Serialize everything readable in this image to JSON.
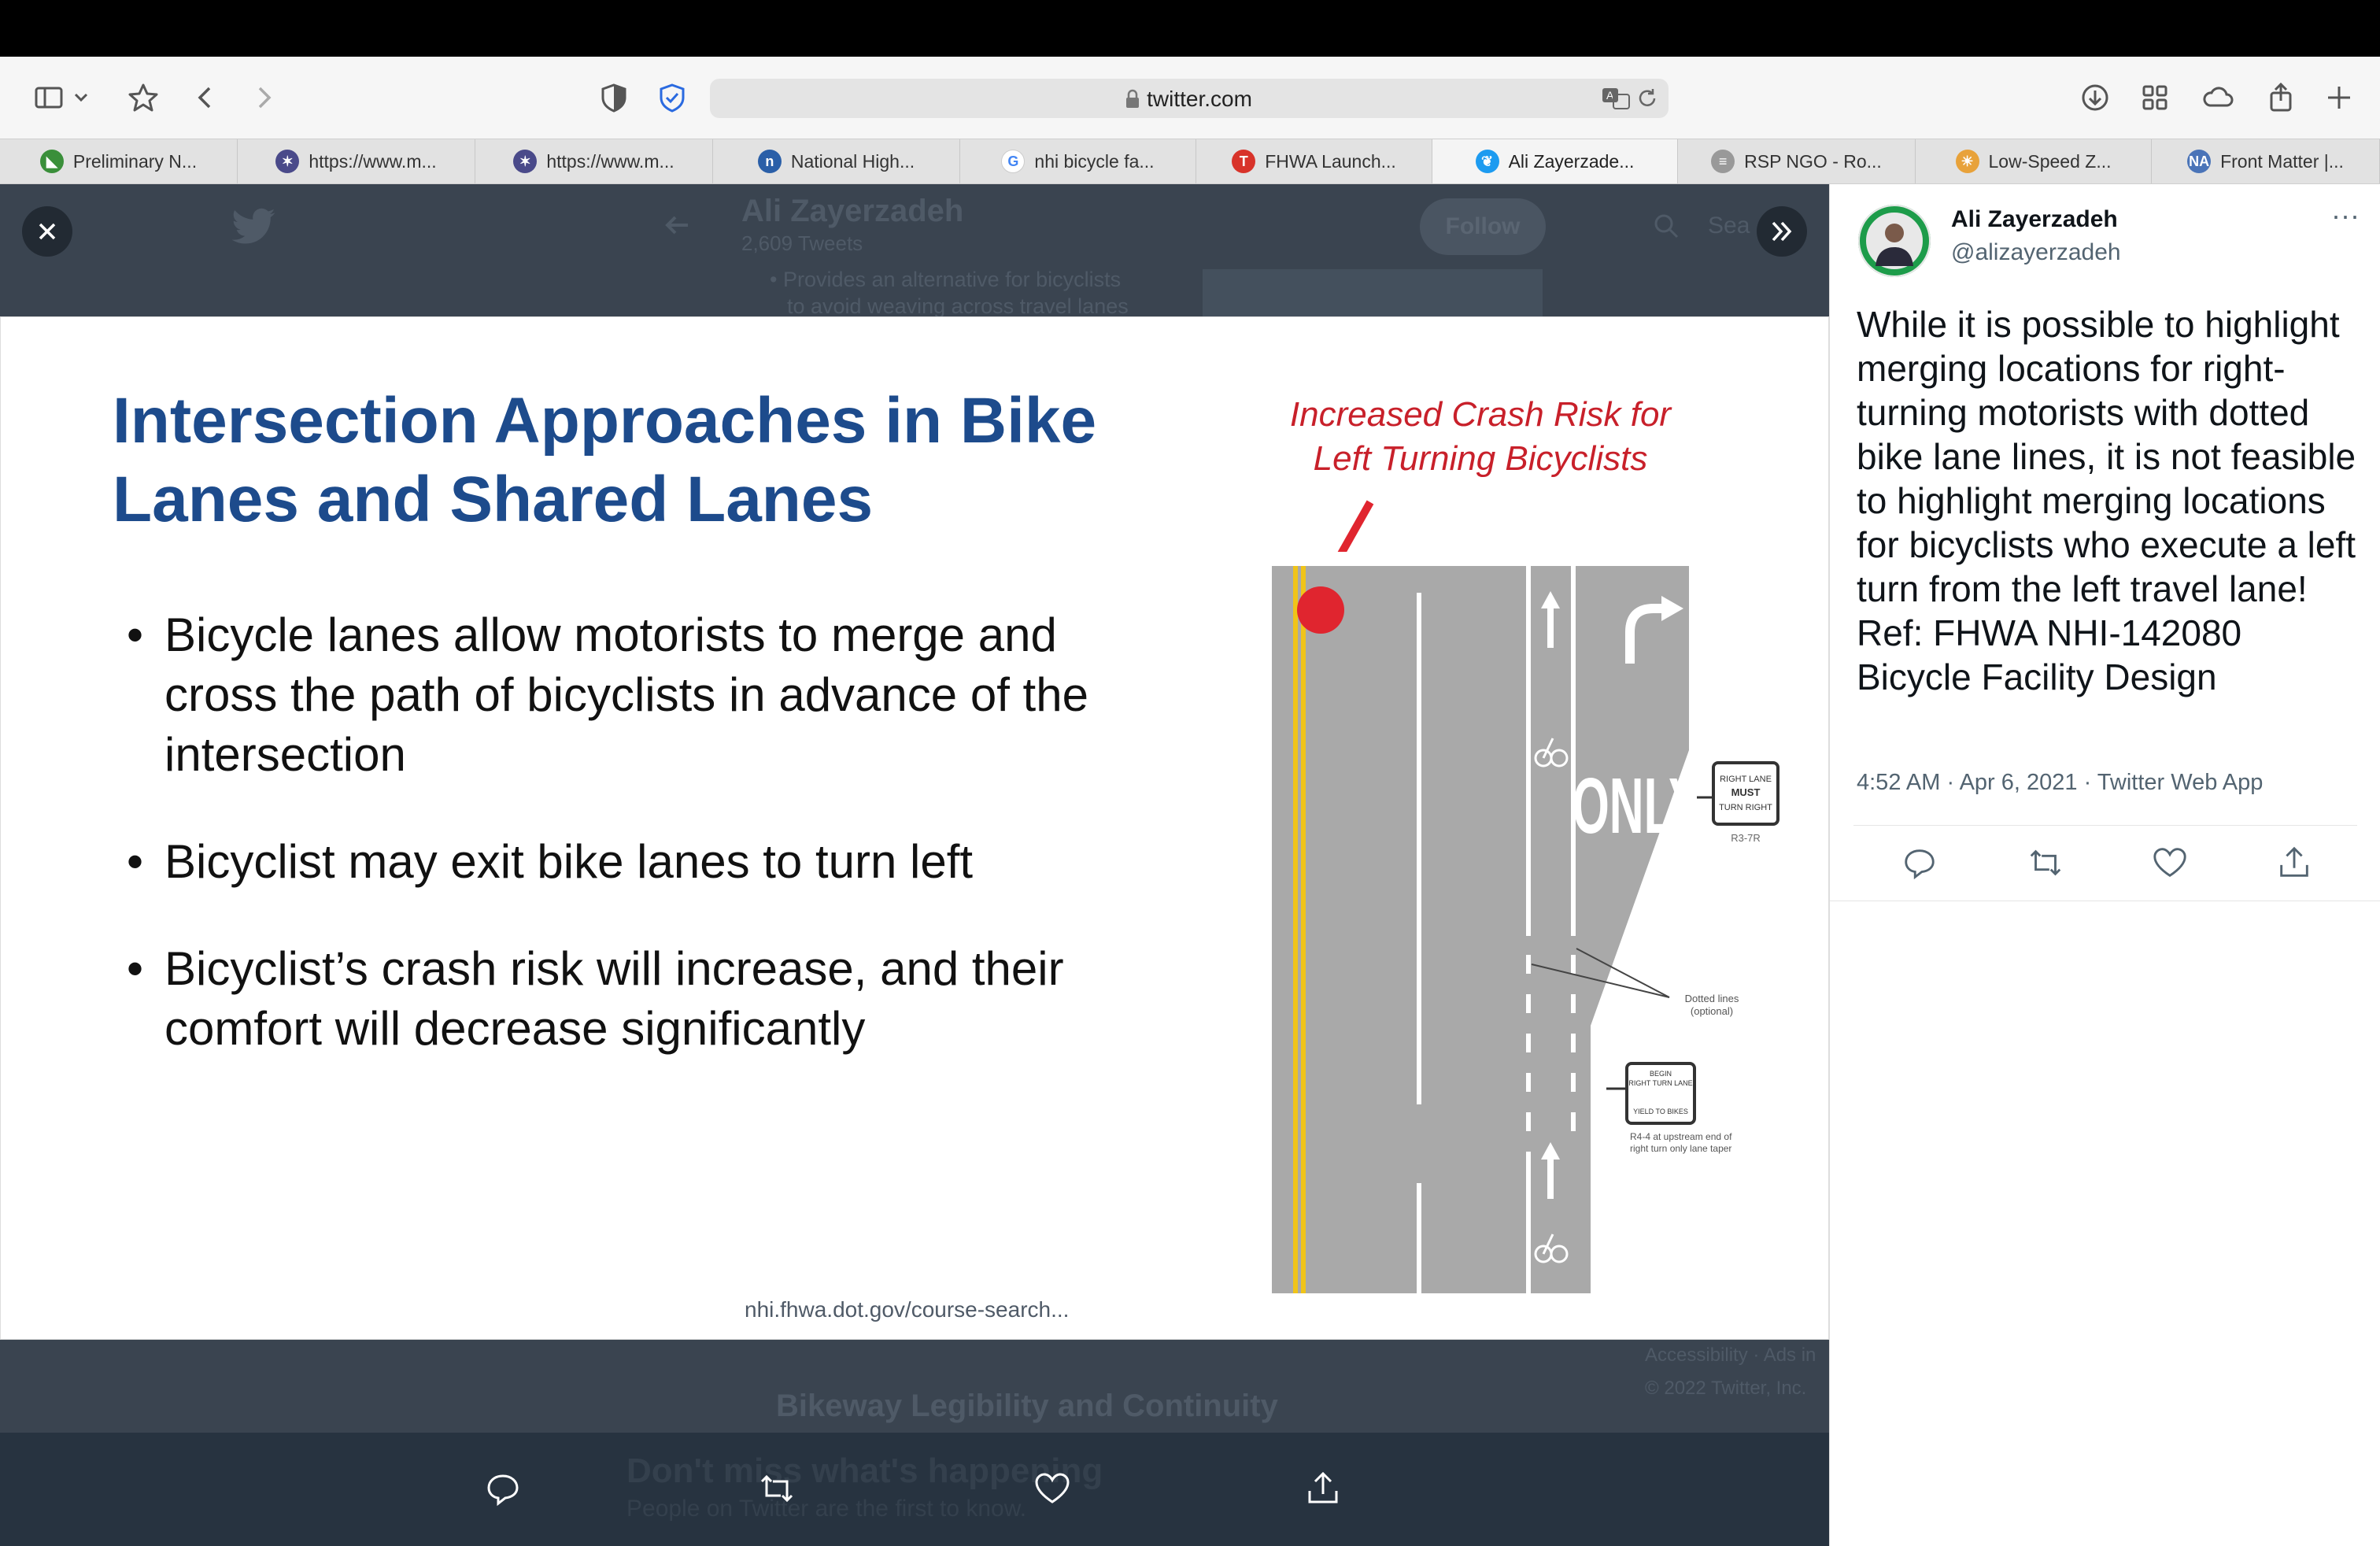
{
  "browser": {
    "url": "twitter.com",
    "icons": [
      "sidebar-icon",
      "chevron-down-icon",
      "bookmark-star-icon",
      "back-icon",
      "forward-icon",
      "privacy-shield-icon",
      "password-shield-icon",
      "lock-icon",
      "translate-icon",
      "reload-icon",
      "downloads-icon",
      "tab-overview-icon",
      "icloud-icon",
      "share-icon",
      "new-tab-icon"
    ],
    "tabs": [
      {
        "label": "Preliminary N...",
        "favicon": "green-chart-favicon",
        "color": "#3a8f3a"
      },
      {
        "label": "https://www.m...",
        "favicon": "star-favicon",
        "color": "#4a4a8a"
      },
      {
        "label": "https://www.m...",
        "favicon": "star-favicon",
        "color": "#4a4a8a"
      },
      {
        "label": "National High...",
        "favicon": "nhi-favicon",
        "color": "#2a5fa8"
      },
      {
        "label": "nhi bicycle fa...",
        "favicon": "google-favicon",
        "color": "#ffffff"
      },
      {
        "label": "FHWA Launch...",
        "favicon": "t-favicon",
        "color": "#d8332a"
      },
      {
        "label": "Ali Zayerzade...",
        "favicon": "twitter-favicon",
        "color": "#1d9bf0",
        "active": true
      },
      {
        "label": "RSP NGO - Ro...",
        "favicon": "document-favicon",
        "color": "#999999"
      },
      {
        "label": "Low-Speed Z...",
        "favicon": "sun-favicon",
        "color": "#e8a23a"
      },
      {
        "label": "Front Matter |...",
        "favicon": "na-favicon",
        "color": "#4a74b8"
      }
    ]
  },
  "background_page": {
    "profile_name": "Ali Zayerzadeh",
    "tweet_count": "2,609 Tweets",
    "follow_label": "Follow",
    "search_fragment": "Sea",
    "bg_bullet_1": "• Provides an alternative for bicyclists",
    "bg_bullet_2": "to avoid weaving across travel lanes",
    "bg_link": "nhi.fhwa.dot.gov/course-search...",
    "bg_heading": "Bikeway Legibility and Continuity",
    "bg_footer_1": "Accessibility · Ads in",
    "bg_footer_2": "© 2022 Twitter, Inc.",
    "bg_banner_title": "Don't miss what's happening",
    "bg_banner_sub": "People on Twitter are the first to know."
  },
  "slide": {
    "title_line1": "Intersection Approaches in Bike",
    "title_line2": "Lanes and Shared Lanes",
    "bullet_1": "Bicycle lanes allow motorists to merge and cross the path of bicyclists in advance of the intersection",
    "bullet_2": "Bicyclist may exit bike lanes to turn left",
    "bullet_3": "Bicyclist’s crash risk will increase, and their comfort will decrease significantly",
    "diagram_caption_1": "Increased Crash Risk for",
    "diagram_caption_2": "Left Turning Bicyclists",
    "road_text_only": "ONLY",
    "sign_1": "RIGHT LANE MUST TURN RIGHT",
    "sign_1_code": "R3-7R",
    "dotted_label": "Dotted lines (optional)",
    "sign_2": "BEGIN RIGHT TURN LANE YIELD TO BIKES",
    "sign_2_note": "R4-4 at upstream end of right turn only lane taper"
  },
  "tweet": {
    "author_name": "Ali Zayerzadeh",
    "author_handle": "@alizayerzadeh",
    "more_label": "···",
    "text": "While it is possible to highlight merging locations for right-turning motorists with dotted bike lane lines, it is not feasible to highlight merging locations for bicyclists who execute a left turn from the left travel lane!\nRef: FHWA NHI-142080 Bicycle Facility Design",
    "meta": "4:52 AM · Apr 6, 2021 · Twitter Web App"
  },
  "colors": {
    "twitter_blue": "#1d9bf0",
    "slide_title_blue": "#1d4b8c",
    "crash_red": "#c8202a",
    "overlay_bg": "#3a4450"
  }
}
